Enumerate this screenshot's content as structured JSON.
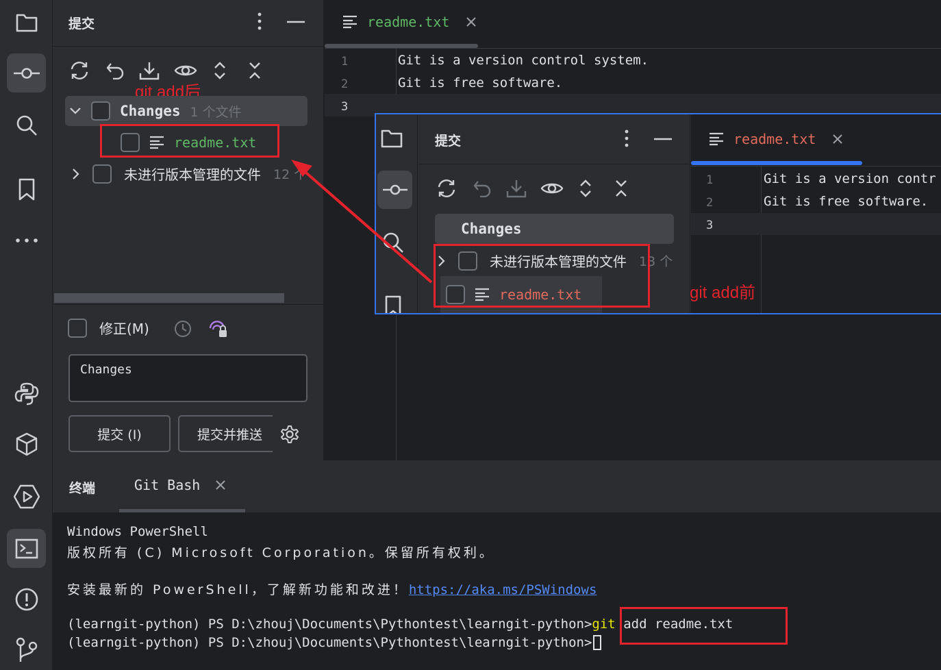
{
  "commit_panel": {
    "title": "提交",
    "changes_label": "Changes",
    "changes_count": "1 个文件",
    "staged_file": "readme.txt",
    "unversioned_label": "未进行版本管理的文件",
    "unversioned_count": "12 个",
    "annotation_after": "git add后",
    "amend_label": "修正(M)",
    "message_text": "Changes",
    "commit_button": "提交 (I)",
    "commit_push_button": "提交并推送"
  },
  "editor": {
    "tab_label": "readme.txt",
    "line_numbers": [
      "1",
      "2",
      "3"
    ],
    "lines": [
      "Git is a version control system.",
      "Git is free software.",
      ""
    ]
  },
  "overlay": {
    "panel_title": "提交",
    "changes_label": "Changes",
    "unversioned_label": "未进行版本管理的文件",
    "unversioned_count": "13 个",
    "file_label": "readme.txt",
    "annotation_before": "git add前",
    "tab_label": "readme.txt",
    "line_numbers": [
      "1",
      "2",
      "3"
    ],
    "lines": [
      "Git is a version contr",
      "Git is free software.",
      ""
    ]
  },
  "terminal": {
    "tab_label": "终端",
    "session_tab": "Git Bash",
    "line1": "Windows PowerShell",
    "line2": "版权所有 (C) Microsoft Corporation。保留所有权利。",
    "line3_prefix": "安装最新的 PowerShell，了解新功能和改进！",
    "line3_link": "https://aka.ms/PSWindows",
    "prompt": "(learngit-python) PS D:\\zhouj\\Documents\\Pythontest\\learngit-python>",
    "cmd_git": "git",
    "cmd_rest": " add readme.txt"
  },
  "colors": {
    "added_file": "#5fb865",
    "unversioned_file": "#e36b5c",
    "annotation": "#e5232c",
    "accent": "#3574f0",
    "link": "#548af7",
    "cmd_highlight": "#e6e600"
  },
  "icons": [
    "folder-icon",
    "commit-icon",
    "search-icon",
    "bookmark-icon",
    "more-icon",
    "python-icon",
    "python-packages-icon",
    "run-icon",
    "terminal-icon",
    "problems-icon",
    "git-icon",
    "refresh-icon",
    "rollback-icon",
    "update-icon",
    "eye-icon",
    "expand-icon",
    "collapse-icon",
    "history-icon",
    "ai-icon",
    "settings-icon",
    "file-lines-icon",
    "close-icon",
    "chevron-icon"
  ]
}
